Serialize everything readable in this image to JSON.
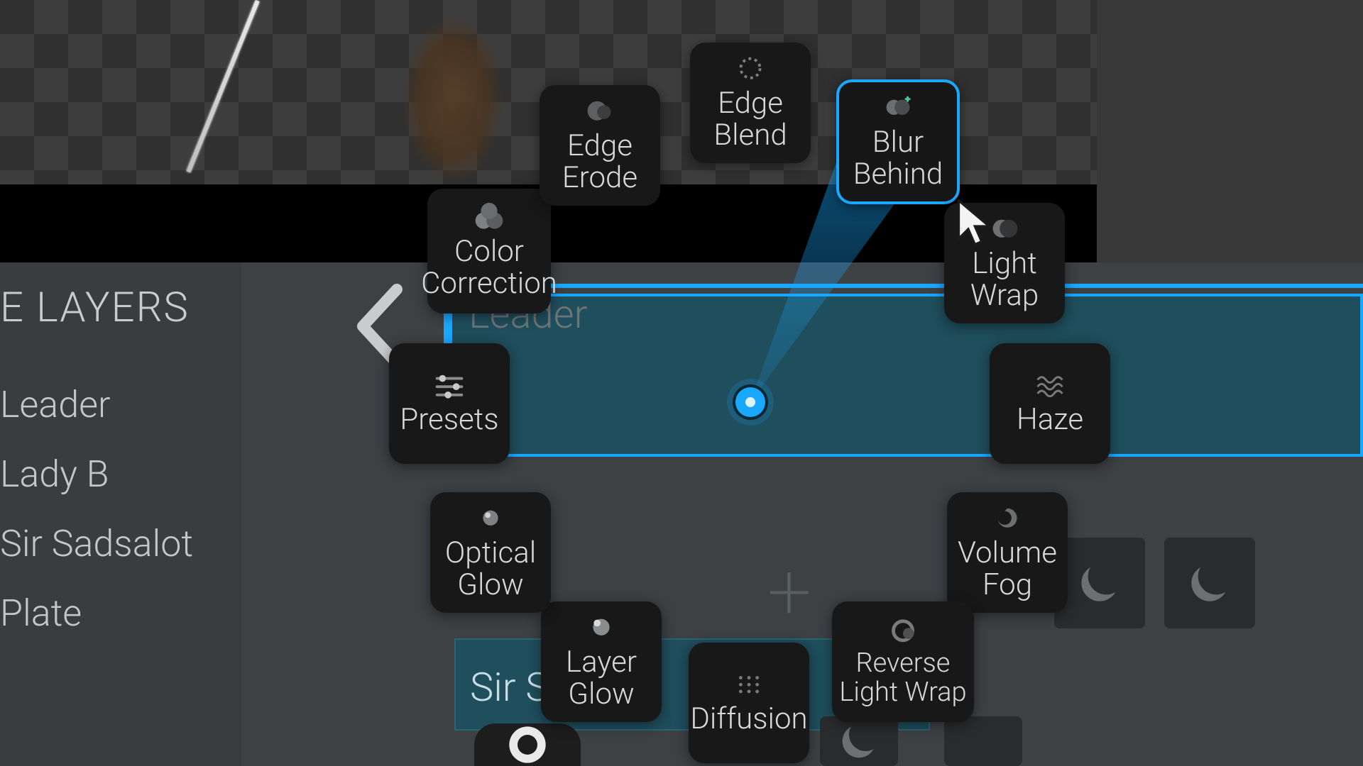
{
  "panel_title": "E LAYERS",
  "layers": [
    {
      "name": "Leader"
    },
    {
      "name": "Lady B"
    },
    {
      "name": "Sir Sadsalot"
    },
    {
      "name": "Plate"
    }
  ],
  "faded_track_label": "Leader",
  "lower_track_label": "Sir Sa",
  "radial": {
    "selected_index": 3,
    "items": [
      {
        "id": "color-correction",
        "label": "Color\nCorrection",
        "icon": "tricircle"
      },
      {
        "id": "edge-erode",
        "label": "Edge\nErode",
        "icon": "erode"
      },
      {
        "id": "edge-blend",
        "label": "Edge\nBlend",
        "icon": "dashed-circle"
      },
      {
        "id": "blur-behind",
        "label": "Blur\nBehind",
        "icon": "blur-cross"
      },
      {
        "id": "light-wrap",
        "label": "Light\nWrap",
        "icon": "halfmoon"
      },
      {
        "id": "haze",
        "label": "Haze",
        "icon": "wave-grid"
      },
      {
        "id": "volume-fog",
        "label": "Volume\nFog",
        "icon": "swirl"
      },
      {
        "id": "reverse-light-wrap",
        "label": "Reverse\nLight Wrap",
        "icon": "ringdot"
      },
      {
        "id": "diffusion",
        "label": "Diffusion",
        "icon": "dot-matrix"
      },
      {
        "id": "layer-glow",
        "label": "Layer\nGlow",
        "icon": "glowdot"
      },
      {
        "id": "optical-glow",
        "label": "Optical\nGlow",
        "icon": "glowdot-sm"
      },
      {
        "id": "presets",
        "label": "Presets",
        "icon": "sliders"
      }
    ]
  },
  "colors": {
    "accent": "#1aa8ff",
    "tile_bg": "#181818",
    "track_teal": "#1f4e5c"
  }
}
